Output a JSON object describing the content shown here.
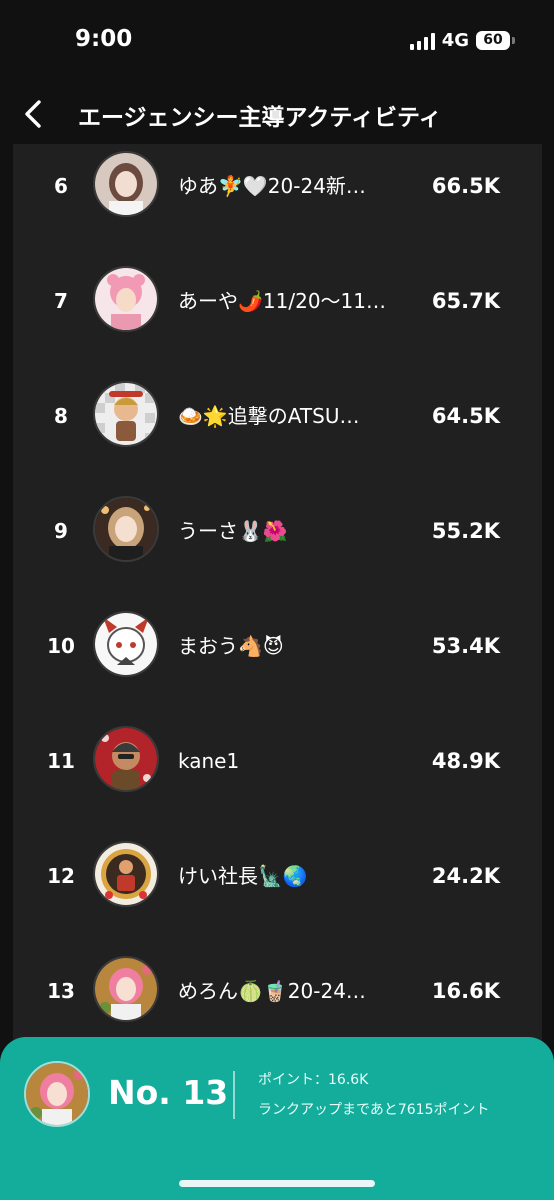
{
  "status_bar": {
    "time": "9:00",
    "network": "4G",
    "battery": "60"
  },
  "header": {
    "title": "エージェンシー主導アクティビティ",
    "back_icon": "chevron-left-icon"
  },
  "ranking": [
    {
      "rank": "6",
      "name": "ゆあ🧚🤍20-24新…",
      "points": "66.5K"
    },
    {
      "rank": "7",
      "name": "あーや🌶️11/20〜11…",
      "points": "65.7K"
    },
    {
      "rank": "8",
      "name": "🍛🌟追撃のATSU…",
      "points": "64.5K"
    },
    {
      "rank": "9",
      "name": "うーさ🐰🌺",
      "points": "55.2K"
    },
    {
      "rank": "10",
      "name": "まおう🐴😈",
      "points": "53.4K"
    },
    {
      "rank": "11",
      "name": "kane1",
      "points": "48.9K"
    },
    {
      "rank": "12",
      "name": "けい社長🗽🌏",
      "points": "24.2K"
    },
    {
      "rank": "13",
      "name": "めろん🍈🧋20-24…",
      "points": "16.6K"
    }
  ],
  "my_status": {
    "rank_label": "No. 13",
    "points": "ポイント：16.6K",
    "next_rank": "ランクアップまであと7615ポイント"
  },
  "colors": {
    "background": "#111111",
    "list_background": "#202020",
    "accent": "#14ad9b",
    "text": "#ffffff"
  }
}
